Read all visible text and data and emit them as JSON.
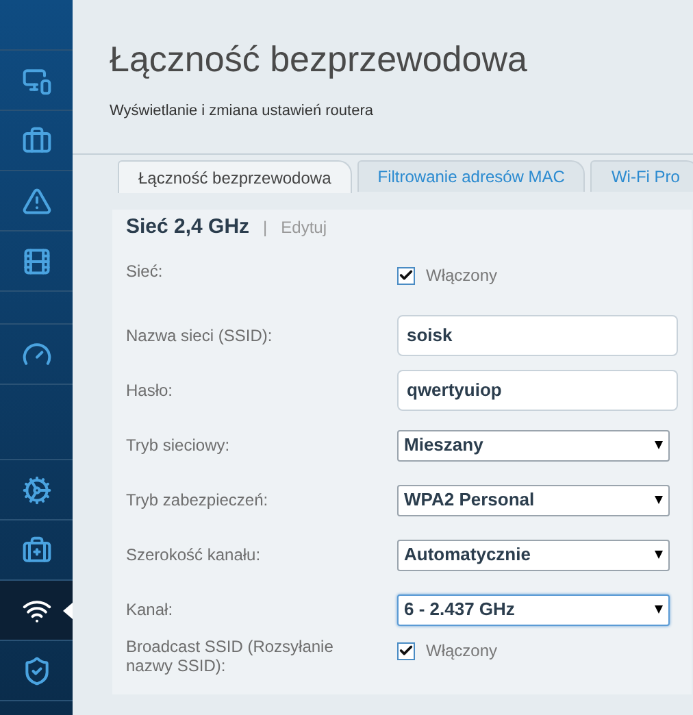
{
  "header": {
    "title": "Łączność bezprzewodowa",
    "subtitle": "Wyświetlanie i zmiana ustawień routera"
  },
  "sidebar": {
    "items": [
      {
        "selected": false
      },
      {
        "selected": false
      },
      {
        "selected": false
      },
      {
        "selected": false
      },
      {
        "selected": false
      },
      {
        "selected": false
      },
      {
        "selected": false
      },
      {
        "selected": true
      },
      {
        "selected": false
      }
    ]
  },
  "tabs": [
    {
      "label": "Łączność bezprzewodowa",
      "selected": true
    },
    {
      "label": "Filtrowanie adresów MAC",
      "selected": false
    },
    {
      "label": "Wi-Fi Pro",
      "selected": false
    }
  ],
  "panel": {
    "title": "Sieć 2,4 GHz",
    "separator": "|",
    "edit_link": "Edytuj",
    "rows": [
      {
        "kind": "checkbox",
        "label": "Sieć:",
        "checked": true,
        "text": "Włączony"
      },
      {
        "kind": "text",
        "label": "Nazwa sieci (SSID):",
        "value": "soisk"
      },
      {
        "kind": "text",
        "label": "Hasło:",
        "value": "qwertyuiop"
      },
      {
        "kind": "select",
        "label": "Tryb sieciowy:",
        "value": "Mieszany",
        "focused": false
      },
      {
        "kind": "select",
        "label": "Tryb zabezpieczeń:",
        "value": "WPA2 Personal",
        "focused": false
      },
      {
        "kind": "select",
        "label": "Szerokość kanału:",
        "value": "Automatycznie",
        "focused": false
      },
      {
        "kind": "select",
        "label": "Kanał:",
        "value": "6 - 2.437 GHz",
        "focused": true
      },
      {
        "kind": "checkbox",
        "label": "Broadcast SSID (Rozsyłanie nazwy SSID):",
        "checked": true,
        "text": "Włączony"
      }
    ]
  }
}
